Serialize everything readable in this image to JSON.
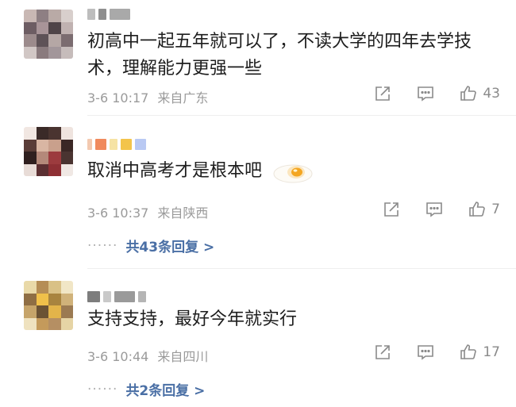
{
  "comments": [
    {
      "text": "初高中一起五年就可以了，不读大学的四年去学技术，理解能力更强一些",
      "date": "3-6 10:17",
      "location": "来自广东",
      "likes": "43",
      "replies_label": ""
    },
    {
      "text": "取消中高考才是根本吧",
      "date": "3-6 10:37",
      "location": "来自陕西",
      "likes": "7",
      "replies_label": "共43条回复 >"
    },
    {
      "text": "支持支持，最好今年就实行",
      "date": "3-6 10:44",
      "location": "来自四川",
      "likes": "17",
      "replies_label": "共2条回复 >"
    }
  ],
  "reply_dots": "······",
  "icons": [
    "share-icon",
    "comment-icon",
    "like-icon",
    "fried-egg-emoji-icon"
  ],
  "colors": {
    "reply_link": "#4a6fa5",
    "meta": "#9a9a9a",
    "text": "#1d1d1d"
  }
}
